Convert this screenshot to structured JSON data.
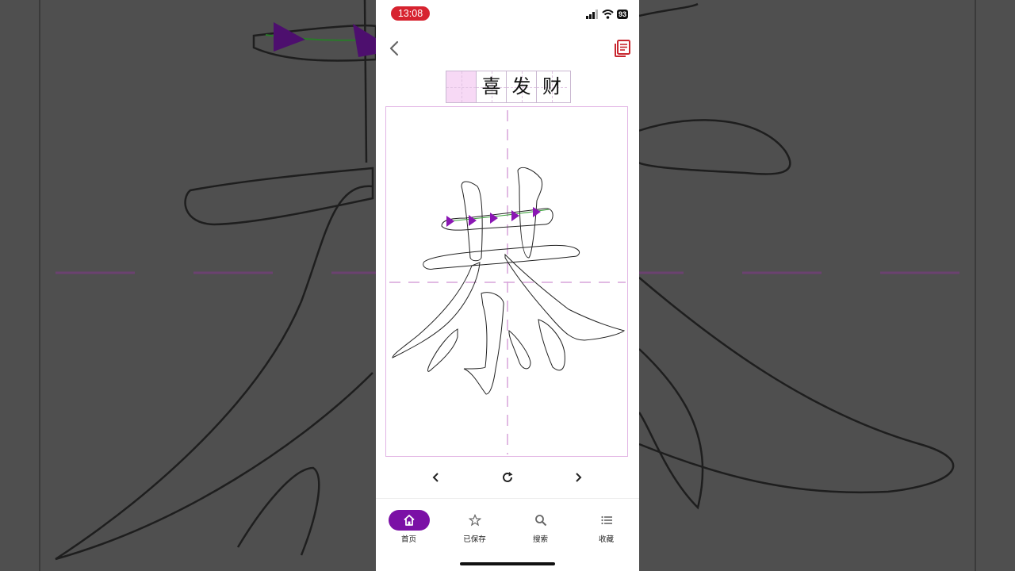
{
  "status_bar": {
    "time": "13:08",
    "battery": "93"
  },
  "nav": {
    "back_icon": "chevron-left-icon",
    "book_icon": "book-list-icon"
  },
  "word": {
    "characters": [
      "",
      "喜",
      "发",
      "财"
    ],
    "active_index": 0
  },
  "controls": {
    "prev_icon": "chevron-left-icon",
    "replay_icon": "refresh-icon",
    "next_icon": "chevron-right-icon"
  },
  "tabs": [
    {
      "label": "首页",
      "icon": "home-icon",
      "active": true
    },
    {
      "label": "已保存",
      "icon": "star-icon",
      "active": false
    },
    {
      "label": "搜索",
      "icon": "search-icon",
      "active": false
    },
    {
      "label": "收藏",
      "icon": "list-icon",
      "active": false
    }
  ],
  "colors": {
    "accent": "#7b10a6",
    "time_pill": "#d7232f",
    "grid": "#e2b5e4",
    "stroke_guide": "#3aa03a"
  }
}
